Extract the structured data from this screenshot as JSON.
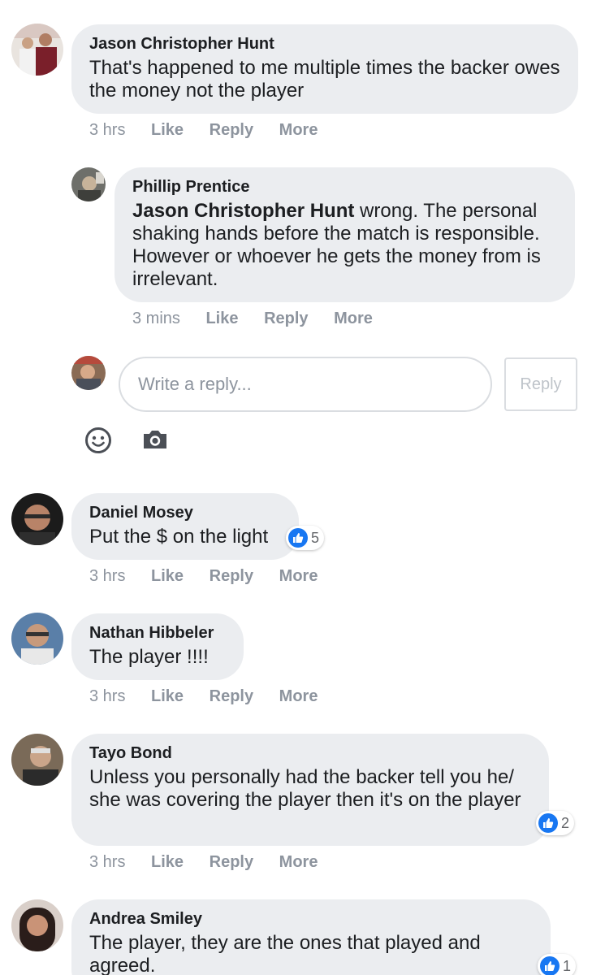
{
  "comments": [
    {
      "author": "Jason Christopher Hunt",
      "text": "That's happened to me multiple times the backer owes the money not the player",
      "time": "3 hrs",
      "like": "Like",
      "reply": "Reply",
      "more": "More"
    },
    {
      "author": "Phillip Prentice",
      "mention": "Jason Christopher Hunt",
      "text": " wrong. The personal shaking hands before the match is responsible. However or whoever he gets the money from is irrelevant.",
      "time": "3 mins",
      "like": "Like",
      "reply": "Reply",
      "more": "More"
    },
    {
      "author": "Daniel Mosey",
      "text": "Put the $ on the light",
      "time": "3 hrs",
      "like": "Like",
      "reply": "Reply",
      "more": "More",
      "reactions": "5"
    },
    {
      "author": "Nathan Hibbeler",
      "text": "The player !!!!",
      "time": "3 hrs",
      "like": "Like",
      "reply": "Reply",
      "more": "More"
    },
    {
      "author": "Tayo Bond",
      "text": "Unless you personally had the backer tell you he/ she was covering the player then it's on the player",
      "time": "3 hrs",
      "like": "Like",
      "reply": "Reply",
      "more": "More",
      "reactions": "2"
    },
    {
      "author": "Andrea Smiley",
      "text": "The player, they are the ones that played and agreed.",
      "reactions": "1"
    }
  ],
  "reply_box": {
    "placeholder": "Write a reply...",
    "button": "Reply"
  },
  "icons": {
    "emoji": "smiley-icon",
    "camera": "camera-icon",
    "like": "thumbs-up-icon"
  },
  "colors": {
    "bubble": "#ebedf0",
    "like_blue": "#1877f2",
    "meta_gray": "#8d949e"
  }
}
